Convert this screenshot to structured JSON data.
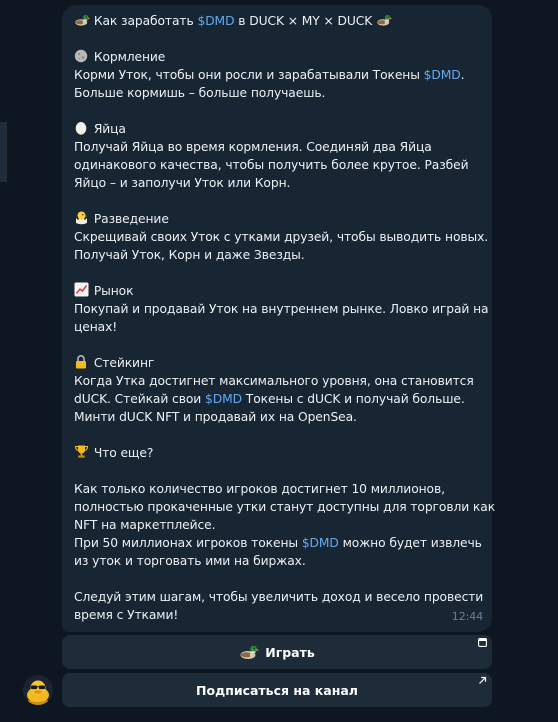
{
  "message": {
    "lines": [
      {
        "type": "header",
        "icon": "duck-icon",
        "text_before": "Как заработать ",
        "dmd": "$DMD",
        "text_after": " в DUCK × MY × DUCK"
      },
      {
        "type": "blank"
      },
      {
        "type": "heading",
        "icon": "moon-icon",
        "text": "Кормление"
      },
      {
        "type": "rich",
        "before": "Корми Уток, чтобы они росли и зарабатывали Токены ",
        "dmd": "$DMD",
        "after": "."
      },
      {
        "type": "plain",
        "text": "Больше кормишь – больше получаешь."
      },
      {
        "type": "blank"
      },
      {
        "type": "heading",
        "icon": "egg-icon",
        "text": "Яйца"
      },
      {
        "type": "plain",
        "text": "Получай Яйца во время кормления. Соединяй два Яйца"
      },
      {
        "type": "plain",
        "text": "одинакового качества, чтобы получить более крутое. Разбей"
      },
      {
        "type": "plain",
        "text": "Яйцо – и заполучи Уток или Корн."
      },
      {
        "type": "blank"
      },
      {
        "type": "heading",
        "icon": "hatching-chick-icon",
        "text": "Разведение"
      },
      {
        "type": "plain",
        "text": "Скрещивай своих Уток с утками друзей, чтобы выводить новых."
      },
      {
        "type": "plain",
        "text": "Получай Уток, Корн и даже Звезды."
      },
      {
        "type": "blank"
      },
      {
        "type": "heading",
        "icon": "chart-up-icon",
        "text": "Рынок"
      },
      {
        "type": "plain",
        "text": "Покупай и продавай Уток на внутреннем рынке. Ловко играй на"
      },
      {
        "type": "plain",
        "text": "ценах!"
      },
      {
        "type": "blank"
      },
      {
        "type": "heading",
        "icon": "lock-icon",
        "text": "Стейкинг"
      },
      {
        "type": "plain",
        "text": "Когда Утка достигнет максимального уровня, она становится"
      },
      {
        "type": "rich",
        "before": "dUCK. Стейкай свои ",
        "dmd": "$DMD",
        "after": " Токены с dUCK и получай больше."
      },
      {
        "type": "plain",
        "text": "Минти dUCK NFT и продавай их на OpenSea."
      },
      {
        "type": "blank"
      },
      {
        "type": "heading",
        "icon": "trophy-icon",
        "text": "Что еще?"
      },
      {
        "type": "blank"
      },
      {
        "type": "plain",
        "text": "Как только количество игроков достигнет 10 миллионов,"
      },
      {
        "type": "plain",
        "text": "полностью прокаченные утки станут доступны для торговли как"
      },
      {
        "type": "plain",
        "text": "NFT на маркетплейсе."
      },
      {
        "type": "rich",
        "before": "При 50 миллионах игроков токены ",
        "dmd": "$DMD",
        "after": " можно будет извлечь"
      },
      {
        "type": "plain",
        "text": "из уток и торговать ими на биржах."
      },
      {
        "type": "blank"
      },
      {
        "type": "plain",
        "text": "Следуй этим шагам, чтобы увеличить доход и весело провести"
      },
      {
        "type": "plain",
        "text": "время с Утками!"
      }
    ],
    "time": "12:44"
  },
  "buttons": {
    "play_label": "Играть",
    "play_icon": "duck-icon",
    "subscribe_label": "Подписаться на канал"
  },
  "colors": {
    "background": "#0e1621",
    "bubble": "#182533",
    "button": "#1e2c3a",
    "accent_link": "#62a9f3"
  }
}
